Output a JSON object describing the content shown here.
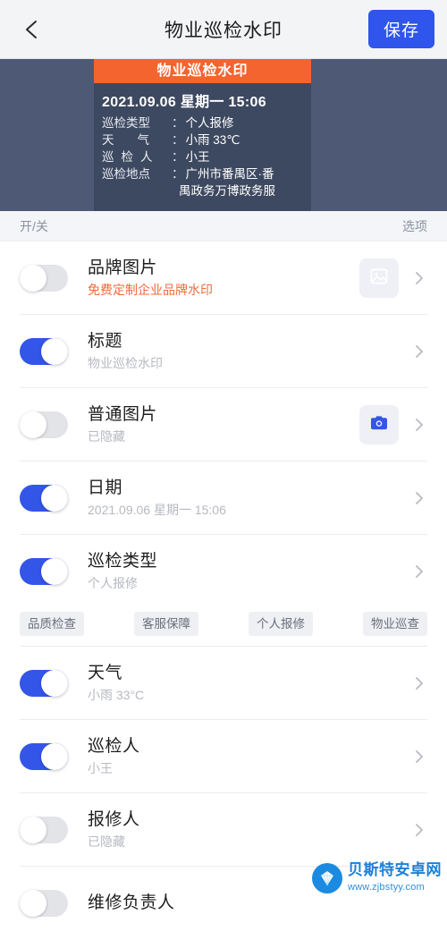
{
  "header": {
    "back_icon": "arrow-left-icon",
    "title": "物业巡检水印",
    "save_label": "保存",
    "accent_color": "#2f55ec"
  },
  "preview": {
    "background_color": "#4e5a75",
    "card_background_color": "#3d4960",
    "title_bar_color": "#f4642e",
    "title": "物业巡检水印",
    "datetime": "2021.09.06 星期一 15:06",
    "fields": [
      {
        "key": "巡检类型",
        "value": "个人报修"
      },
      {
        "key": "天气",
        "value": "小雨 33℃"
      },
      {
        "key": "巡检人",
        "value": "小王"
      },
      {
        "key": "巡检地点",
        "value": "广州市番禺区·番",
        "value_line2": "禺政务万博政务服"
      }
    ],
    "colon": "："
  },
  "column_bar": {
    "left_label": "开/关",
    "right_label": "选项"
  },
  "rows": [
    {
      "name": "brand-image",
      "title": "品牌图片",
      "subtitle": "免费定制企业品牌水印",
      "subtitle_style": "promo",
      "toggle": "off",
      "thumb": "image-icon"
    },
    {
      "name": "title",
      "title": "标题",
      "subtitle": "物业巡检水印",
      "subtitle_style": "normal",
      "toggle": "on",
      "thumb": null
    },
    {
      "name": "normal-image",
      "title": "普通图片",
      "subtitle": "已隐藏",
      "subtitle_style": "normal",
      "toggle": "off",
      "thumb": "camera-icon"
    },
    {
      "name": "date",
      "title": "日期",
      "subtitle": "2021.09.06 星期一 15:06",
      "subtitle_style": "normal",
      "toggle": "on",
      "thumb": null
    },
    {
      "name": "inspection-type",
      "title": "巡检类型",
      "subtitle": "个人报修",
      "subtitle_style": "normal",
      "toggle": "on",
      "thumb": null
    },
    {
      "name": "weather",
      "title": "天气",
      "subtitle": "小雨 33°C",
      "subtitle_style": "normal",
      "toggle": "on",
      "thumb": null
    },
    {
      "name": "inspector",
      "title": "巡检人",
      "subtitle": "小王",
      "subtitle_style": "normal",
      "toggle": "on",
      "thumb": null
    },
    {
      "name": "reporter",
      "title": "报修人",
      "subtitle": "已隐藏",
      "subtitle_style": "normal",
      "toggle": "off",
      "thumb": null
    },
    {
      "name": "repair-manager",
      "title": "维修负责人",
      "subtitle": "",
      "subtitle_style": "normal",
      "toggle": "off",
      "thumb": null
    }
  ],
  "type_chips": [
    {
      "label": "品质检查",
      "selected": false
    },
    {
      "label": "客服保障",
      "selected": false
    },
    {
      "label": "个人报修",
      "selected": false
    },
    {
      "label": "物业巡查",
      "selected": false
    }
  ],
  "site_watermark": {
    "name": "贝斯特安卓网",
    "url": "www.zjbstyy.com"
  }
}
